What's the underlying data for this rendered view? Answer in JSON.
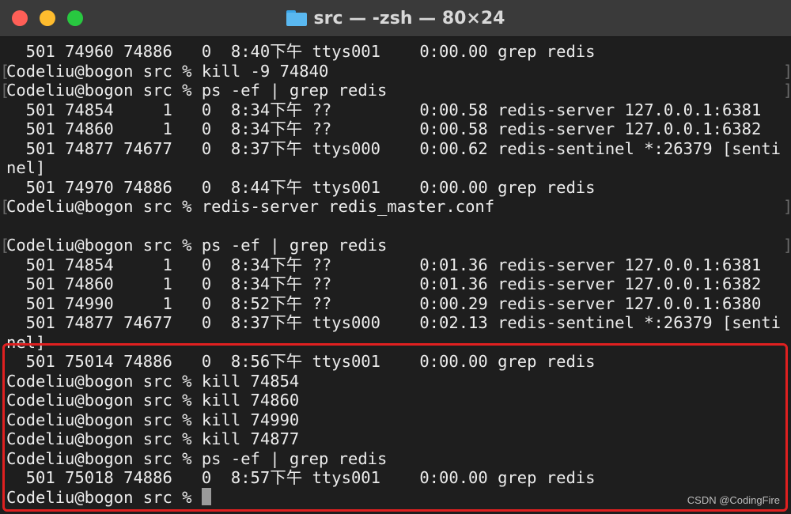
{
  "window": {
    "title": "src — -zsh — 80×24",
    "folder_icon": "folder-icon"
  },
  "terminal": {
    "lines": [
      "  501 74960 74886   0  8:40下午 ttys001    0:00.00 grep redis",
      "Codeliu@bogon src % kill -9 74840",
      "Codeliu@bogon src % ps -ef | grep redis",
      "  501 74854     1   0  8:34下午 ??         0:00.58 redis-server 127.0.0.1:6381",
      "  501 74860     1   0  8:34下午 ??         0:00.58 redis-server 127.0.0.1:6382",
      "  501 74877 74677   0  8:37下午 ttys000    0:00.62 redis-sentinel *:26379 [senti",
      "nel]",
      "  501 74970 74886   0  8:44下午 ttys001    0:00.00 grep redis",
      "Codeliu@bogon src % redis-server redis_master.conf",
      "",
      "Codeliu@bogon src % ps -ef | grep redis",
      "  501 74854     1   0  8:34下午 ??         0:01.36 redis-server 127.0.0.1:6381",
      "  501 74860     1   0  8:34下午 ??         0:01.36 redis-server 127.0.0.1:6382",
      "  501 74990     1   0  8:52下午 ??         0:00.29 redis-server 127.0.0.1:6380",
      "  501 74877 74677   0  8:37下午 ttys000    0:02.13 redis-sentinel *:26379 [senti",
      "nel]",
      "  501 75014 74886   0  8:56下午 ttys001    0:00.00 grep redis",
      "Codeliu@bogon src % kill 74854",
      "Codeliu@bogon src % kill 74860",
      "Codeliu@bogon src % kill 74990",
      "Codeliu@bogon src % kill 74877",
      "Codeliu@bogon src % ps -ef | grep redis",
      "  501 75018 74886   0  8:57下午 ttys001    0:00.00 grep redis"
    ],
    "prompt": "Codeliu@bogon src % "
  },
  "watermark": "CSDN @CodingFire",
  "colors": {
    "close": "#ff5f57",
    "minimize": "#febc2e",
    "maximize": "#28c840",
    "highlight_border": "#e02020"
  }
}
